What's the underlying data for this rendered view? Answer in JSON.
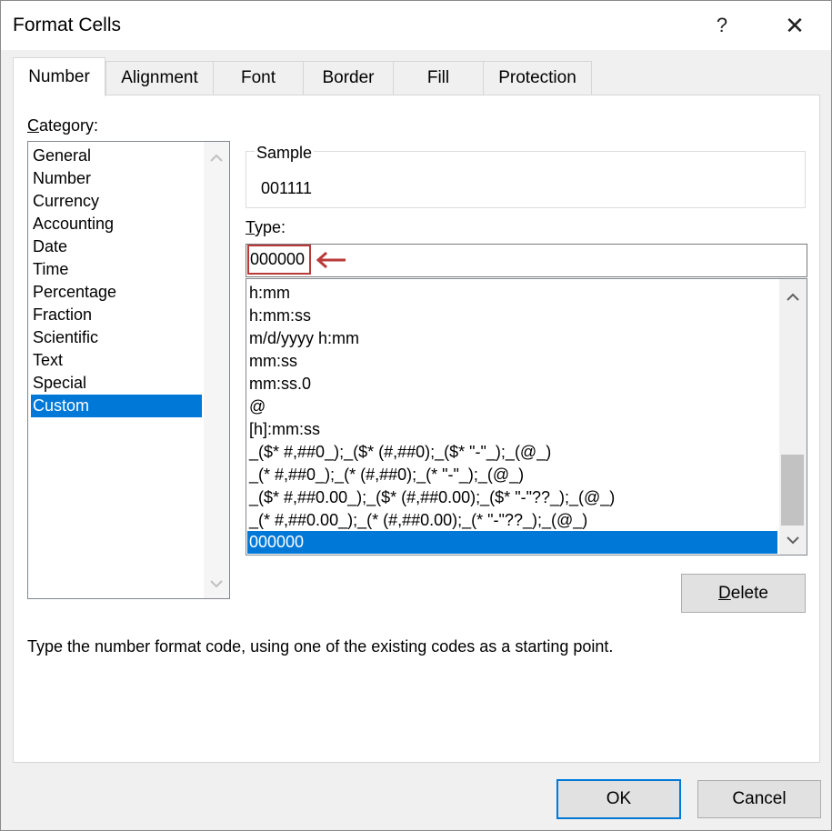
{
  "window": {
    "title": "Format Cells",
    "help_glyph": "?",
    "close_glyph": "✕"
  },
  "tabs": [
    {
      "label": "Number"
    },
    {
      "label": "Alignment"
    },
    {
      "label": "Font"
    },
    {
      "label": "Border"
    },
    {
      "label": "Fill"
    },
    {
      "label": "Protection"
    }
  ],
  "category": {
    "label_key": "C",
    "label_rest": "ategory:",
    "items": [
      "General",
      "Number",
      "Currency",
      "Accounting",
      "Date",
      "Time",
      "Percentage",
      "Fraction",
      "Scientific",
      "Text",
      "Special",
      "Custom"
    ],
    "selected": "Custom"
  },
  "sample": {
    "label": "Sample",
    "value": "001111"
  },
  "type": {
    "label_key": "T",
    "label_rest": "ype:",
    "value": "000000",
    "formats": [
      "h:mm",
      "h:mm:ss",
      "m/d/yyyy h:mm",
      "mm:ss",
      "mm:ss.0",
      "@",
      "[h]:mm:ss",
      "_($* #,##0_);_($* (#,##0);_($* \"-\"_);_(@_)",
      "_(* #,##0_);_(* (#,##0);_(* \"-\"_);_(@_)",
      "_($* #,##0.00_);_($* (#,##0.00);_($* \"-\"??_);_(@_)",
      "_(* #,##0.00_);_(* (#,##0.00);_(* \"-\"??_);_(@_)",
      "000000"
    ],
    "selected": "000000",
    "scroll_position": 0.82
  },
  "buttons": {
    "delete_key": "D",
    "delete_rest": "elete",
    "ok": "OK",
    "cancel": "Cancel"
  },
  "hint": "Type the number format code, using one of the existing codes as a starting point.",
  "colors": {
    "selection": "#0078d7",
    "highlight": "#b93a3a"
  }
}
